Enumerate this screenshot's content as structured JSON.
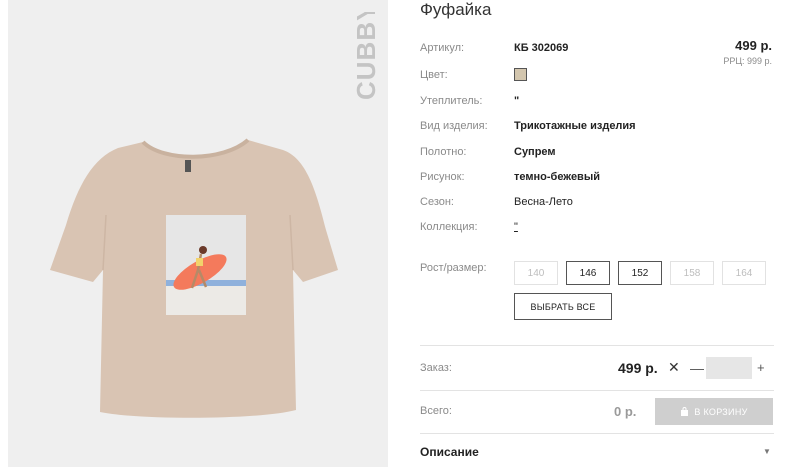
{
  "product": {
    "title": "Фуфайка",
    "brand": "CUBBY",
    "price": "499 р.",
    "rrp": "РРЦ: 999 р."
  },
  "attributes": {
    "article_label": "Артикул:",
    "article_value": "КБ 302069",
    "color_label": "Цвет:",
    "color_swatch": "#d3c6ae",
    "insulation_label": "Утеплитель:",
    "insulation_value": "\"",
    "type_label": "Вид изделия:",
    "type_value": "Трикотажные изделия",
    "fabric_label": "Полотно:",
    "fabric_value": "Супрем",
    "pattern_label": "Рисунок:",
    "pattern_value": "темно-бежевый",
    "season_label": "Сезон:",
    "season_value": "Весна-Лето",
    "collection_label": "Коллекция:",
    "collection_value": "\"",
    "size_label": "Рост/размер:"
  },
  "sizes": [
    {
      "label": "140",
      "available": false
    },
    {
      "label": "146",
      "available": true
    },
    {
      "label": "152",
      "available": true
    },
    {
      "label": "158",
      "available": false
    },
    {
      "label": "164",
      "available": false
    }
  ],
  "select_all_label": "ВЫБРАТЬ ВСЕ",
  "order": {
    "label": "Заказ:",
    "price": "499 р.",
    "times": "✕",
    "minus": "—",
    "plus": "+",
    "quantity": ""
  },
  "total": {
    "label": "Всего:",
    "value": "0 р.",
    "cart_button": "В КОРЗИНУ"
  },
  "description": {
    "label": "Описание",
    "arrow": "▼"
  },
  "colors": {
    "shirt": "#d9c4b3",
    "print_bg": "#e6e6e6",
    "surfboard": "#f47a5c",
    "water": "#8fb1dc",
    "cart_bg": "#cfcfcf"
  }
}
